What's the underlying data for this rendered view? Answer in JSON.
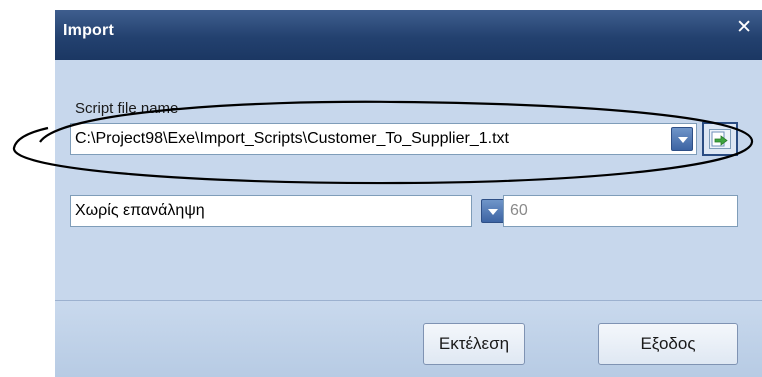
{
  "dialog": {
    "title": "Import",
    "close_glyph": "✕"
  },
  "form": {
    "script_label": "Script file name",
    "script_path": "C:\\Project98\\Exe\\Import_Scripts\\Customer_To_Supplier_1.txt",
    "repeat_option": "Χωρίς επανάληψη",
    "interval_value": "60"
  },
  "footer": {
    "run_label": "Εκτέλεση",
    "exit_label": "Εξοδος"
  },
  "colors": {
    "titlebar": "#23416f",
    "body": "#c7d7ec",
    "annotation": "#000000"
  },
  "icons": {
    "close": "close-icon",
    "dropdown": "chevron-down-icon",
    "browse": "open-file-icon"
  }
}
